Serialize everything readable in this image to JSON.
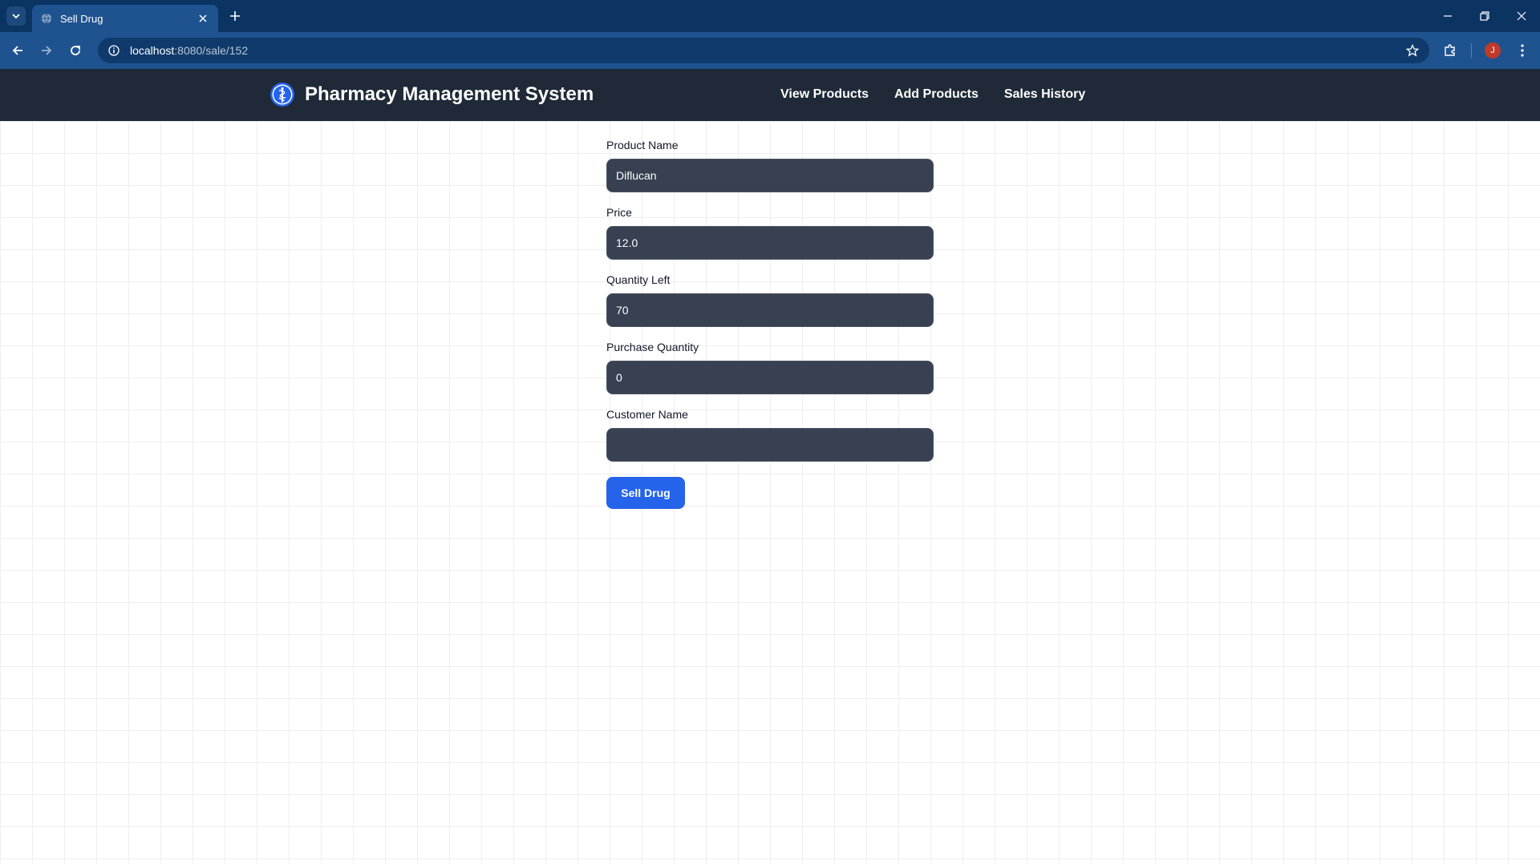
{
  "browser": {
    "tab_title": "Sell Drug",
    "url_host": "localhost",
    "url_path": ":8080/sale/152",
    "avatar_letter": "J"
  },
  "app": {
    "title": "Pharmacy Management System",
    "nav": [
      {
        "label": "View Products"
      },
      {
        "label": "Add Products"
      },
      {
        "label": "Sales History"
      }
    ]
  },
  "form": {
    "fields": [
      {
        "label": "Product Name",
        "value": "Diflucan"
      },
      {
        "label": "Price",
        "value": "12.0"
      },
      {
        "label": "Quantity Left",
        "value": "70"
      },
      {
        "label": "Purchase Quantity",
        "value": "0"
      },
      {
        "label": "Customer Name",
        "value": ""
      }
    ],
    "submit_label": "Sell Drug"
  },
  "colors": {
    "header_bg": "#1f2937",
    "input_bg": "#374151",
    "button_bg": "#2563eb",
    "browser_frame": "#0b3463"
  }
}
